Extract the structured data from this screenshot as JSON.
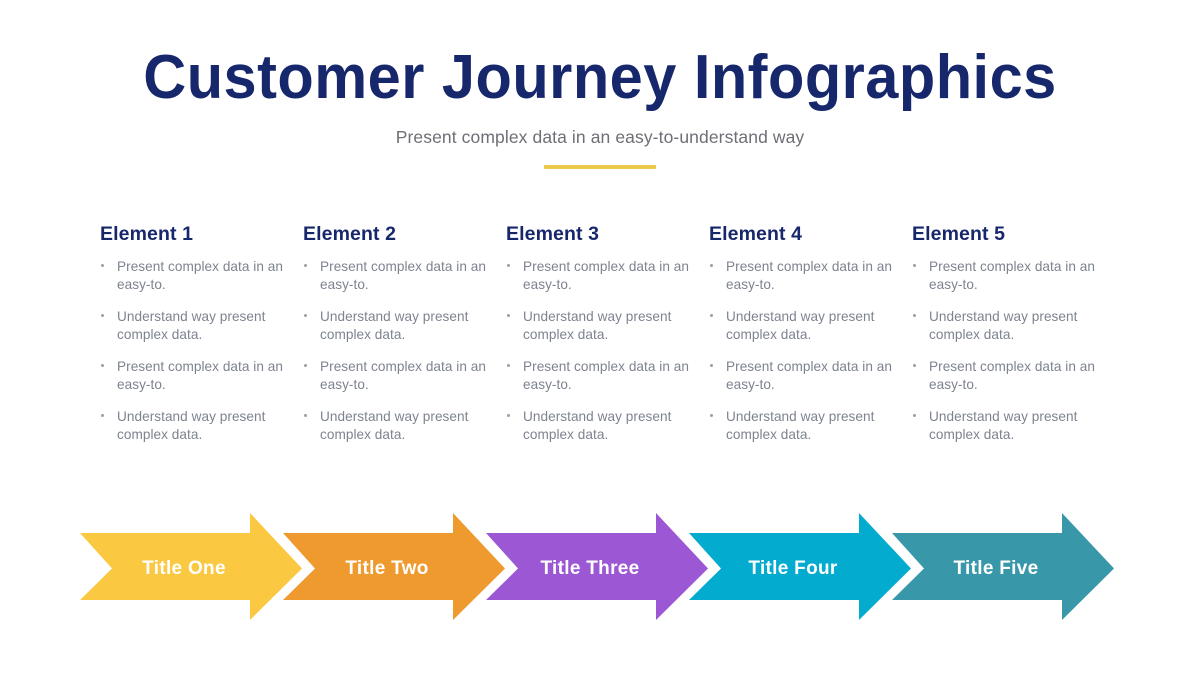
{
  "header": {
    "title": "Customer Journey Infographics",
    "subtitle": "Present complex data in an easy-to-understand way",
    "rule_color": "#EBC94B",
    "title_color": "#17276B",
    "subtitle_color": "#6E6E76"
  },
  "columns": [
    {
      "heading": "Element 1",
      "bullets": [
        "Present complex data in an easy-to.",
        "Understand way present complex data.",
        "Present complex data in an easy-to.",
        "Understand way present complex data."
      ]
    },
    {
      "heading": "Element 2",
      "bullets": [
        "Present complex data in an easy-to.",
        "Understand way present complex data.",
        "Present complex data in an easy-to.",
        "Understand way present complex data."
      ]
    },
    {
      "heading": "Element 3",
      "bullets": [
        "Present complex data in an easy-to.",
        "Understand way present complex data.",
        "Present complex data in an easy-to.",
        "Understand way present complex data."
      ]
    },
    {
      "heading": "Element 4",
      "bullets": [
        "Present complex data in an easy-to.",
        "Understand way present complex data.",
        "Present complex data in an easy-to.",
        "Understand way present complex data."
      ]
    },
    {
      "heading": "Element 5",
      "bullets": [
        "Present complex data in an easy-to.",
        "Understand way present complex data.",
        "Present complex data in an easy-to.",
        "Understand way present complex data."
      ]
    }
  ],
  "chevrons": [
    {
      "label": "Title One",
      "color": "#FBC842"
    },
    {
      "label": "Title Two",
      "color": "#EF9A2F"
    },
    {
      "label": "Title Three",
      "color": "#9C57D4"
    },
    {
      "label": "Title Four",
      "color": "#03ABCE"
    },
    {
      "label": "Title Five",
      "color": "#3897A8"
    }
  ]
}
